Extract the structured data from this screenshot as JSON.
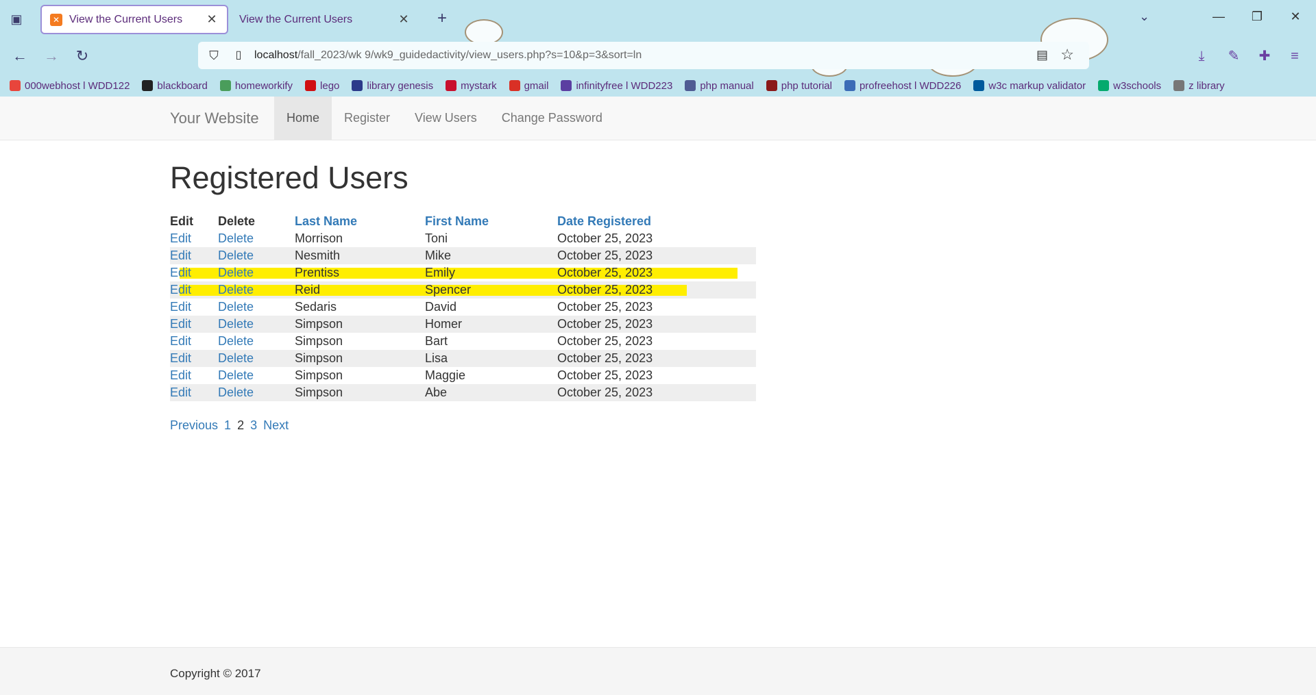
{
  "browser": {
    "tabs": [
      {
        "title": "View the Current Users",
        "active": true
      },
      {
        "title": "View the Current Users",
        "active": false
      }
    ],
    "url_host": "localhost",
    "url_path": "/fall_2023/wk 9/wk9_guidedactivity/view_users.php?s=10&p=3&sort=ln",
    "bookmarks": [
      {
        "label": "000webhost l WDD122",
        "icon": "webhost-icon",
        "color": "#e8453c"
      },
      {
        "label": "blackboard",
        "icon": "blackboard-icon",
        "color": "#222222"
      },
      {
        "label": "homeworkify",
        "icon": "books-icon",
        "color": "#4a9d5b"
      },
      {
        "label": "lego",
        "icon": "lego-icon",
        "color": "#d01012"
      },
      {
        "label": "library genesis",
        "icon": "libgen-icon",
        "color": "#2b3a8a"
      },
      {
        "label": "mystark",
        "icon": "mystark-icon",
        "color": "#c8102e"
      },
      {
        "label": "gmail",
        "icon": "gmail-icon",
        "color": "#d93025"
      },
      {
        "label": "infinityfree l WDD223",
        "icon": "infinity-icon",
        "color": "#5b3ea1"
      },
      {
        "label": "php manual",
        "icon": "php-icon",
        "color": "#4f5b93"
      },
      {
        "label": "php tutorial",
        "icon": "hl-icon",
        "color": "#8b1a1a"
      },
      {
        "label": "profreehost l WDD226",
        "icon": "profreehost-icon",
        "color": "#3b6cb7"
      },
      {
        "label": "w3c markup validator",
        "icon": "w3c-icon",
        "color": "#005a9c"
      },
      {
        "label": "w3schools",
        "icon": "w3schools-icon",
        "color": "#04aa6d"
      },
      {
        "label": "z library",
        "icon": "zlib-icon",
        "color": "#777777"
      }
    ]
  },
  "site": {
    "brand": "Your Website",
    "nav": [
      "Home",
      "Register",
      "View Users",
      "Change Password"
    ],
    "heading": "Registered Users",
    "columns": {
      "edit": "Edit",
      "delete": "Delete",
      "last": "Last Name",
      "first": "First Name",
      "date": "Date Registered"
    },
    "rows": [
      {
        "edit": "Edit",
        "delete": "Delete",
        "last": "Morrison",
        "first": "Toni",
        "date": "October 25, 2023"
      },
      {
        "edit": "Edit",
        "delete": "Delete",
        "last": "Nesmith",
        "first": "Mike",
        "date": "October 25, 2023"
      },
      {
        "edit": "Edit",
        "delete": "Delete",
        "last": "Prentiss",
        "first": "Emily",
        "date": "October 25, 2023"
      },
      {
        "edit": "Edit",
        "delete": "Delete",
        "last": "Reid",
        "first": "Spencer",
        "date": "October 25, 2023"
      },
      {
        "edit": "Edit",
        "delete": "Delete",
        "last": "Sedaris",
        "first": "David",
        "date": "October 25, 2023"
      },
      {
        "edit": "Edit",
        "delete": "Delete",
        "last": "Simpson",
        "first": "Homer",
        "date": "October 25, 2023"
      },
      {
        "edit": "Edit",
        "delete": "Delete",
        "last": "Simpson",
        "first": "Bart",
        "date": "October 25, 2023"
      },
      {
        "edit": "Edit",
        "delete": "Delete",
        "last": "Simpson",
        "first": "Lisa",
        "date": "October 25, 2023"
      },
      {
        "edit": "Edit",
        "delete": "Delete",
        "last": "Simpson",
        "first": "Maggie",
        "date": "October 25, 2023"
      },
      {
        "edit": "Edit",
        "delete": "Delete",
        "last": "Simpson",
        "first": "Abe",
        "date": "October 25, 2023"
      }
    ],
    "pager": {
      "previous": "Previous",
      "p1": "1",
      "current": "2",
      "p3": "3",
      "next": "Next"
    },
    "footer": "Copyright © 2017",
    "highlight_color": "#ffee00",
    "link_color": "#337ab7"
  }
}
